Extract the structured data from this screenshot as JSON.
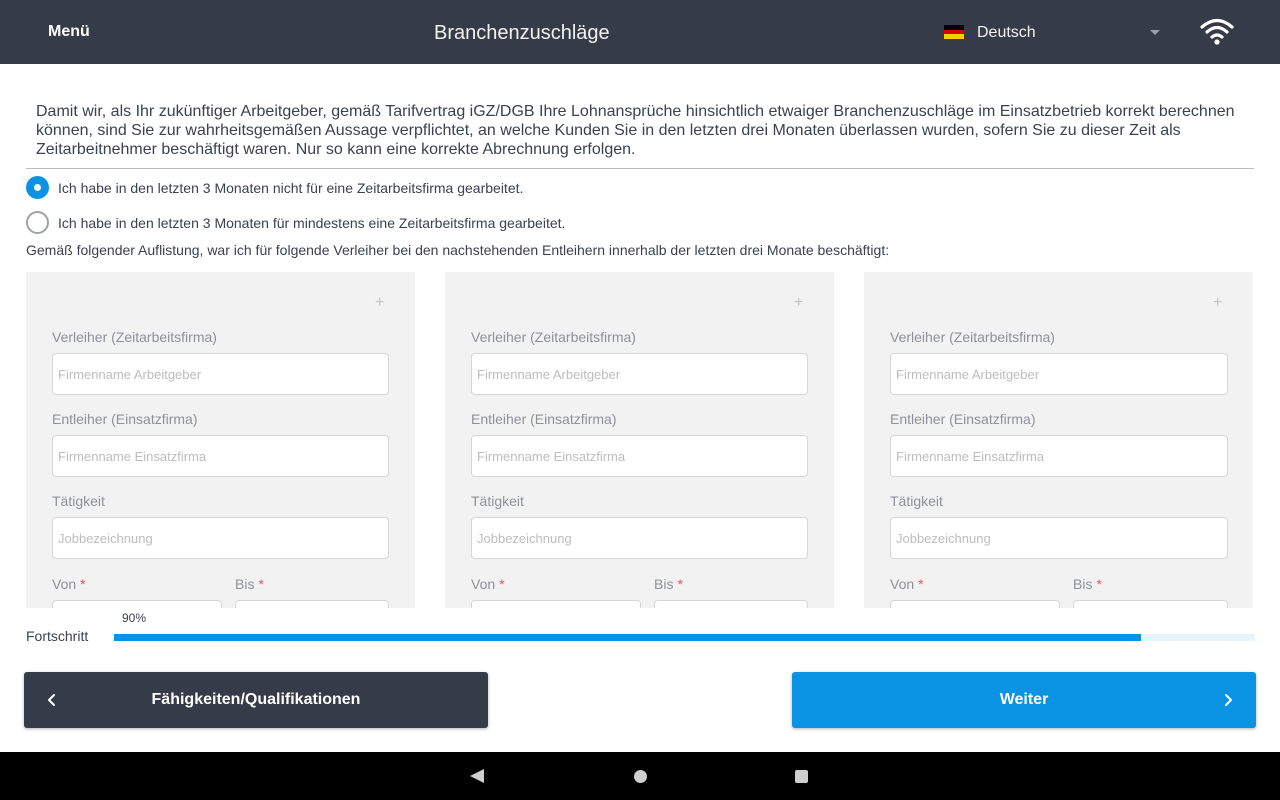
{
  "header": {
    "menu_label": "Menü",
    "title": "Branchenzuschläge",
    "language_label": "Deutsch",
    "language_flag": "germany-flag-icon",
    "status_icon": "wifi-icon",
    "background_color": "#353b47"
  },
  "intro_text": "Damit wir, als Ihr zukünftiger Arbeitgeber, gemäß Tarifvertrag iGZ/DGB Ihre Lohnansprüche hinsichtlich etwaiger Branchenzuschläge im Einsatzbetrieb korrekt berechnen können, sind Sie zur wahrheitsgemäßen Aussage verpflichtet, an welche Kunden Sie in den letzten drei Monaten überlassen wurden, sofern Sie zu dieser Zeit als Zeitarbeitnehmer beschäftigt waren. Nur so kann eine korrekte Abrechnung erfolgen.",
  "options": [
    {
      "label": "Ich habe in den letzten 3 Monaten nicht für eine Zeitarbeitsfirma gearbeitet.",
      "checked": true
    },
    {
      "label": "Ich habe in den letzten 3 Monaten für mindestens eine Zeitarbeitsfirma gearbeitet.",
      "checked": false
    }
  ],
  "list_intro": "Gemäß folgender Auflistung, war ich für folgende Verleiher bei den nachstehenden Entleihern innerhalb der letzten drei Monate beschäftigt:",
  "cards": [
    {
      "add_symbol": "+",
      "lender_label": "Verleiher (Zeitarbeitsfirma)",
      "lender_placeholder": "Firmenname Arbeitgeber",
      "borrower_label": "Entleiher (Einsatzfirma)",
      "borrower_placeholder": "Firmenname Einsatzfirma",
      "job_label": "Tätigkeit",
      "job_placeholder": "Jobbezeichnung",
      "from_label": "Von",
      "to_label": "Bis",
      "required_mark": "*"
    },
    {
      "add_symbol": "+",
      "lender_label": "Verleiher (Zeitarbeitsfirma)",
      "lender_placeholder": "Firmenname Arbeitgeber",
      "borrower_label": "Entleiher (Einsatzfirma)",
      "borrower_placeholder": "Firmenname Einsatzfirma",
      "job_label": "Tätigkeit",
      "job_placeholder": "Jobbezeichnung",
      "from_label": "Von",
      "to_label": "Bis",
      "required_mark": "*"
    },
    {
      "add_symbol": "+",
      "lender_label": "Verleiher (Zeitarbeitsfirma)",
      "lender_placeholder": "Firmenname Arbeitgeber",
      "borrower_label": "Entleiher (Einsatzfirma)",
      "borrower_placeholder": "Firmenname Einsatzfirma",
      "job_label": "Tätigkeit",
      "job_placeholder": "Jobbezeichnung",
      "from_label": "Von",
      "to_label": "Bis",
      "required_mark": "*"
    }
  ],
  "progress": {
    "label": "Fortschritt",
    "percent_text": "90%",
    "value": 0.9,
    "color": "#0a93e2"
  },
  "buttons": {
    "back_label": "Fähigkeiten/Qualifikationen",
    "back_icon": "chevron-left-icon",
    "next_label": "Weiter",
    "next_icon": "chevron-right-icon",
    "accent_color": "#0a93e2"
  },
  "system_nav": {
    "back_icon": "nav-back-icon",
    "home_icon": "nav-home-icon",
    "recents_icon": "nav-recents-icon"
  }
}
